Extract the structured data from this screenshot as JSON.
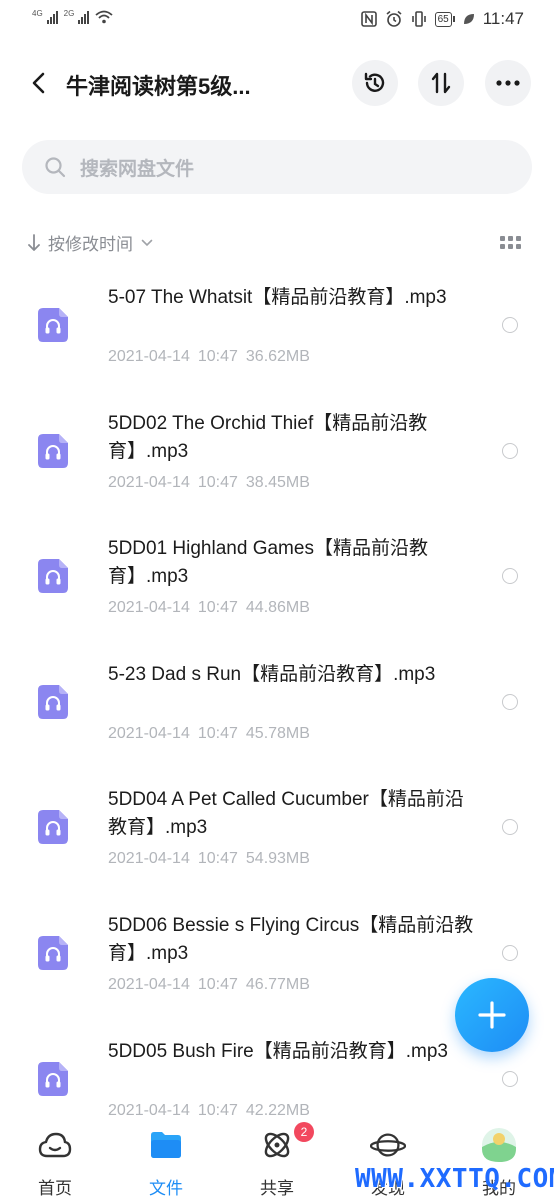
{
  "status_bar": {
    "network_1": "4G",
    "network_2": "2G",
    "battery": "65",
    "time": "11:47"
  },
  "header": {
    "title": "牛津阅读树第5级..."
  },
  "search": {
    "placeholder": "搜索网盘文件"
  },
  "sort": {
    "label": "按修改时间"
  },
  "files": [
    {
      "name": "5-07 The Whatsit【精品前沿教育】.mp3",
      "date": "2021-04-14",
      "time": "10:47",
      "size": "36.62MB"
    },
    {
      "name": "5DD02 The Orchid Thief【精品前沿教育】.mp3",
      "date": "2021-04-14",
      "time": "10:47",
      "size": "38.45MB"
    },
    {
      "name": "5DD01 Highland Games【精品前沿教育】.mp3",
      "date": "2021-04-14",
      "time": "10:47",
      "size": "44.86MB"
    },
    {
      "name": "5-23 Dad s Run【精品前沿教育】.mp3",
      "date": "2021-04-14",
      "time": "10:47",
      "size": "45.78MB"
    },
    {
      "name": "5DD04 A Pet Called Cucumber【精品前沿教育】.mp3",
      "date": "2021-04-14",
      "time": "10:47",
      "size": "54.93MB"
    },
    {
      "name": "5DD06 Bessie s Flying Circus【精品前沿教育】.mp3",
      "date": "2021-04-14",
      "time": "10:47",
      "size": "46.77MB"
    },
    {
      "name": "5DD05 Bush Fire【精品前沿教育】.mp3",
      "date": "2021-04-14",
      "time": "10:47",
      "size": "42.22MB"
    }
  ],
  "nav": {
    "home": "首页",
    "files": "文件",
    "share": "共享",
    "share_badge": "2",
    "discover": "发现",
    "me": "我的"
  },
  "watermark": "WWW.XXTTQ.COM",
  "colors": {
    "accent": "#1e8df5",
    "file_icon": "#8b86f0",
    "badge": "#f2485e"
  }
}
